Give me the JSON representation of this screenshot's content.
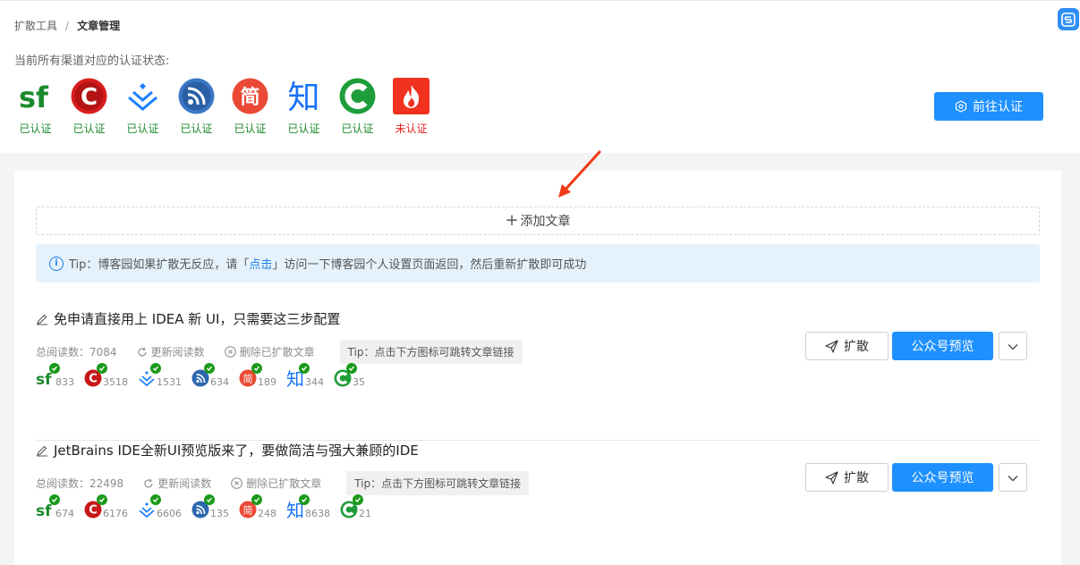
{
  "breadcrumb": {
    "parent": "扩散工具",
    "current": "文章管理"
  },
  "status_title": "当前所有渠道对应的认证状态:",
  "channels": [
    {
      "icon": "sf-icon",
      "status": "已认证",
      "color": "#1b8a2c"
    },
    {
      "icon": "csdn-icon",
      "status": "已认证",
      "color": "#1b8a2c"
    },
    {
      "icon": "juejin-icon",
      "status": "已认证",
      "color": "#1b8a2c"
    },
    {
      "icon": "oschina-rss-icon",
      "status": "已认证",
      "color": "#1b8a2c"
    },
    {
      "icon": "jianshu-icon",
      "status": "已认证",
      "color": "#1b8a2c"
    },
    {
      "icon": "zhihu-icon",
      "status": "已认证",
      "color": "#1b8a2c"
    },
    {
      "icon": "cnblogs-icon",
      "status": "已认证",
      "color": "#1b8a2c"
    },
    {
      "icon": "toutiao-fire-icon",
      "status": "未认证",
      "color": "#e52222"
    }
  ],
  "goto_button": "前往认证",
  "add_article": "添加文章",
  "tip": {
    "before": "Tip：博客园如果扩散无反应，请「",
    "link": "点击",
    "after": "」访问一下博客园个人设置页面返回，然后重新扩散即可成功"
  },
  "articles": [
    {
      "title": "免申请直接用上 IDEA 新 UI，只需要这三步配置",
      "reads_label": "总阅读数：7084",
      "refresh": "更新阅读数",
      "delete": "删除已扩散文章",
      "tip": "Tip：点击下方图标可跳转文章链接",
      "counts": [
        "833",
        "3518",
        "1531",
        "634",
        "189",
        "344",
        "35"
      ]
    },
    {
      "title": "JetBrains IDE全新UI预览版来了，要做简洁与强大兼顾的IDE",
      "reads_label": "总阅读数：22498",
      "refresh": "更新阅读数",
      "delete": "删除已扩散文章",
      "tip": "Tip：点击下方图标可跳转文章链接",
      "counts": [
        "674",
        "6176",
        "6606",
        "135",
        "248",
        "8638",
        "21"
      ]
    }
  ],
  "buttons": {
    "spread": "扩散",
    "preview": "公众号预览"
  }
}
